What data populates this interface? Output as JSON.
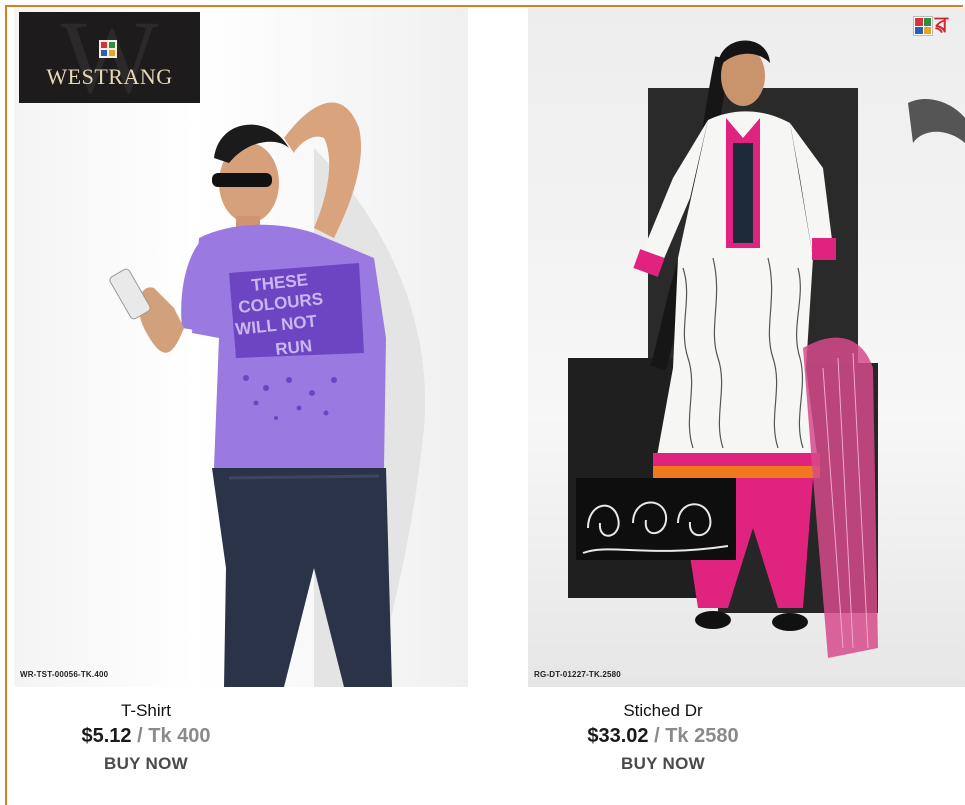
{
  "products": [
    {
      "brand": "WESTRANG",
      "sku": "WR-TST-00056-TK.400",
      "shirt_text": "THESE COLOURS WILL NOT RUN",
      "title": "T-Shirt",
      "price_usd": "$5.12",
      "price_sep": " / ",
      "price_tk": "Tk 400",
      "buy_label": "BUY NOW"
    },
    {
      "sku": "RG-DT-01227-TK.2580",
      "title": "Stiched Dr",
      "price_usd": "$33.02",
      "price_sep": " / ",
      "price_tk": "Tk 2580",
      "buy_label": "BUY NOW"
    }
  ],
  "colors": {
    "frame_border": "#e07a24",
    "tshirt": "#9a7ae0",
    "kameez_trim": "#e0237f",
    "usd_text": "#1a1a1a",
    "tk_text": "#8a8a8a"
  }
}
